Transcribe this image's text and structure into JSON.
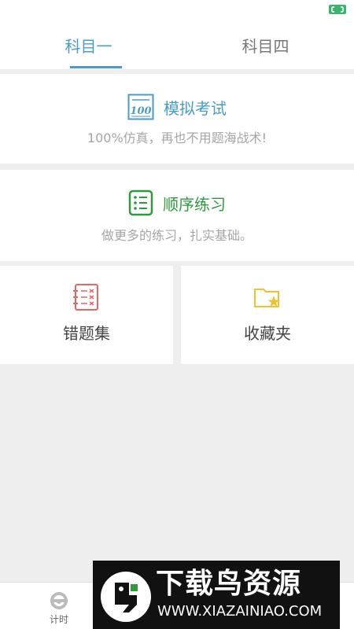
{
  "colors": {
    "accent_blue": "#4a9cc7",
    "accent_green": "#2e9a3a",
    "error_red": "#e46666",
    "star_yellow": "#f2c12e"
  },
  "tabs": [
    {
      "label": "科目一",
      "selected": true
    },
    {
      "label": "科目四",
      "selected": false
    }
  ],
  "mock_exam": {
    "icon": "exam-100-icon",
    "title": "模拟考试",
    "subtitle": "100%仿真，再也不用题海战术!"
  },
  "sequential": {
    "icon": "list-icon",
    "title": "顺序练习",
    "subtitle": "做更多的练习，扎实基础。"
  },
  "tiles": [
    {
      "icon": "wrong-questions-icon",
      "label": "错题集"
    },
    {
      "icon": "favorites-folder-icon",
      "label": "收藏夹"
    }
  ],
  "bottom_nav": [
    {
      "icon": "steering-wheel-icon",
      "label": "计时"
    }
  ],
  "watermark": {
    "title": "下载鸟资源",
    "url": "WWW.XIAZAINIAO.COM"
  }
}
